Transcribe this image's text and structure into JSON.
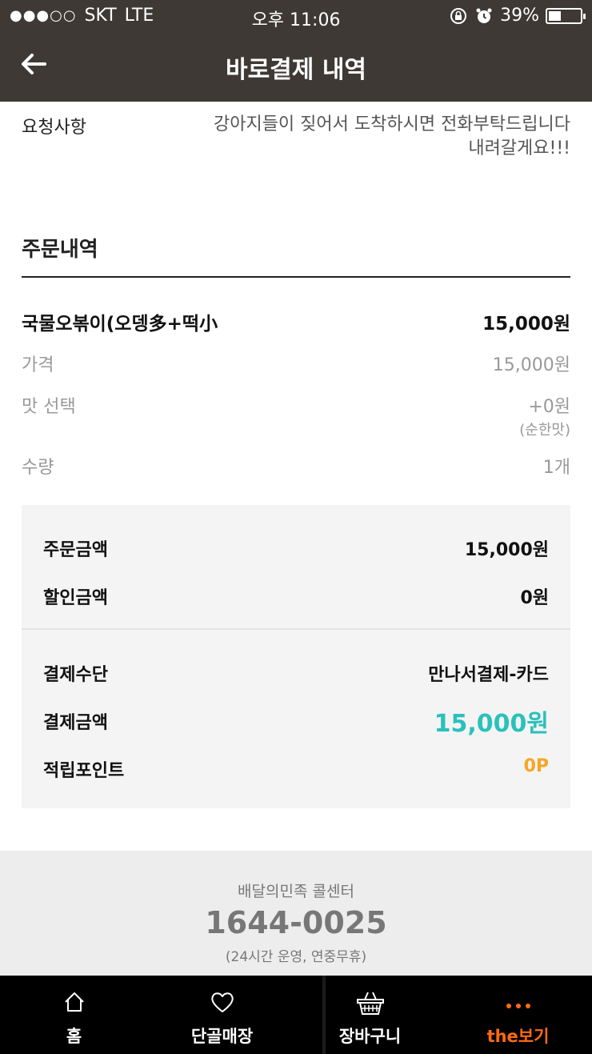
{
  "status": {
    "carrier": "SKT",
    "network": "LTE",
    "time": "오후 11:06",
    "battery": "39%",
    "battery_level": 0.39
  },
  "header": {
    "title": "바로결제 내역"
  },
  "request": {
    "label": "요청사항",
    "value": "강아지들이 짖어서 도착하시면 전화부탁드립니다 내려갈게요!!!"
  },
  "order": {
    "section_title": "주문내역",
    "item": {
      "name": "국물오볶이(오뎅多+떡小",
      "price": "15,000원"
    },
    "details": [
      {
        "label": "가격",
        "value": "15,000원"
      },
      {
        "label": "맛 선택",
        "value": "+0원",
        "note": "(순한맛)"
      },
      {
        "label": "수량",
        "value": "1개"
      }
    ]
  },
  "summary": {
    "order_amount_label": "주문금액",
    "order_amount": "15,000원",
    "discount_label": "할인금액",
    "discount": "0원",
    "payment_method_label": "결제수단",
    "payment_method": "만나서결제-카드",
    "payment_amount_label": "결제금액",
    "payment_amount": "15,000원",
    "points_label": "적립포인트",
    "points": "0P"
  },
  "call_center": {
    "label": "배달의민족 콜센터",
    "phone": "1644-0025",
    "note": "(24시간 운영, 연중무휴)"
  },
  "tabbar": {
    "tabs": [
      {
        "label": "홈",
        "icon": "home-icon"
      },
      {
        "label": "단골매장",
        "icon": "heart-icon"
      },
      {
        "label": "장바구니",
        "icon": "basket-icon"
      },
      {
        "label": "the보기",
        "icon": "more-dots-icon"
      }
    ]
  },
  "colors": {
    "header_bg": "#3e3934",
    "teal": "#2ac1bc",
    "orange": "#f5a623",
    "tab_active": "#ff6a13"
  }
}
